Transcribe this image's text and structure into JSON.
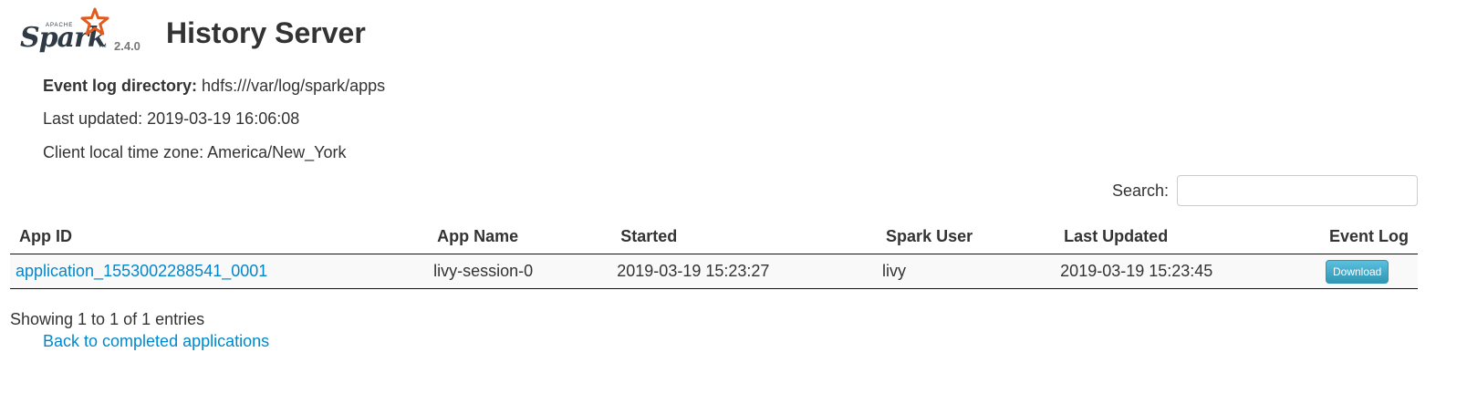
{
  "logo": {
    "brand": "Spark",
    "apache": "APACHE",
    "tm": "TM",
    "version": "2.4.0",
    "star_color": "#e25a1c"
  },
  "header": {
    "title": "History Server"
  },
  "info": {
    "event_log_label": "Event log directory:",
    "event_log_value": "hdfs:///var/log/spark/apps",
    "last_updated": "Last updated: 2019-03-19 16:06:08",
    "time_zone": "Client local time zone: America/New_York"
  },
  "search": {
    "label": "Search:",
    "value": "",
    "placeholder": ""
  },
  "table": {
    "columns": [
      "App ID",
      "App Name",
      "Started",
      "Spark User",
      "Last Updated",
      "Event Log"
    ],
    "rows": [
      {
        "app_id": "application_1553002288541_0001",
        "app_name": "livy-session-0",
        "started": "2019-03-19 15:23:27",
        "spark_user": "livy",
        "last_updated": "2019-03-19 15:23:45",
        "event_log_button": "Download"
      }
    ]
  },
  "footer": {
    "showing": "Showing 1 to 1 of 1 entries",
    "back_link": "Back to completed applications"
  },
  "colors": {
    "link": "#0088cc",
    "button": "#49afcd",
    "text": "#333333"
  }
}
